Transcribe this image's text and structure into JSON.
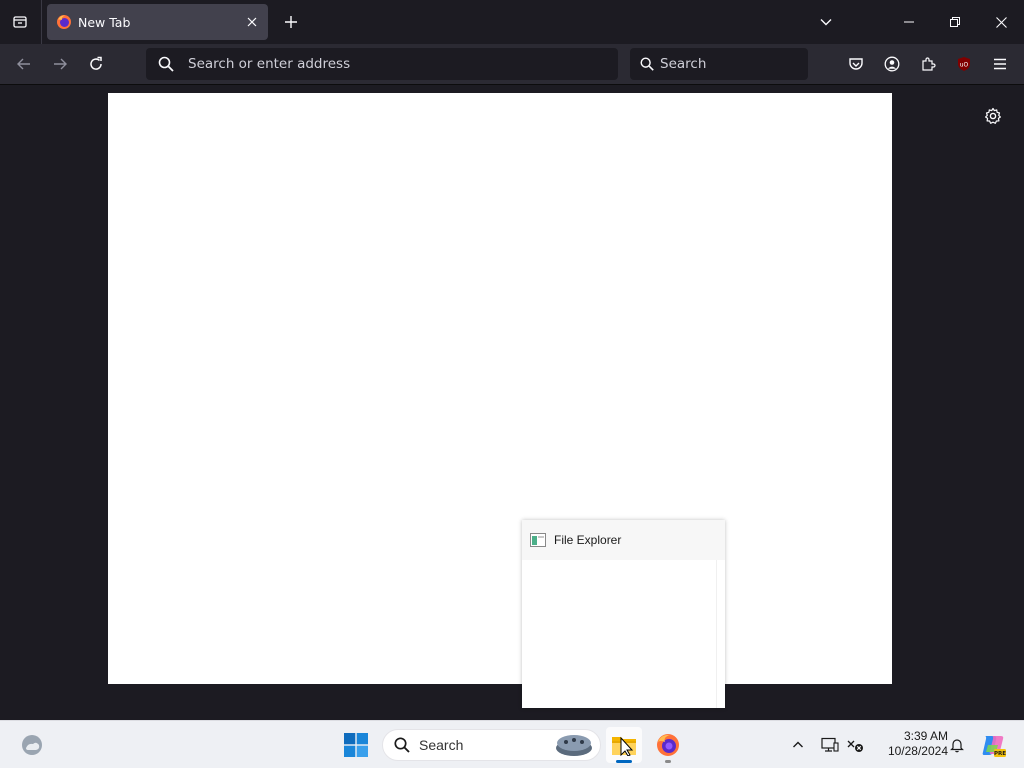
{
  "browser": {
    "tab": {
      "title": "New Tab"
    },
    "urlbar": {
      "placeholder": "Search or enter address"
    },
    "searchbar": {
      "placeholder": "Search"
    },
    "icons": {
      "tab_overview": "list-all-tabs-icon",
      "favicon": "firefox-icon",
      "tab_close": "close-icon",
      "new_tab": "plus-icon",
      "tab_list": "chevron-down-icon",
      "minimize": "minimize-icon",
      "restore": "restore-icon",
      "close_window": "close-icon",
      "back": "arrow-left-icon",
      "forward": "arrow-right-icon",
      "reload": "reload-icon",
      "search": "search-icon",
      "pocket": "pocket-icon",
      "account": "account-icon",
      "extensions": "puzzle-icon",
      "ublock": "ublock-origin-icon",
      "menu": "hamburger-menu-icon",
      "settings": "gear-icon"
    }
  },
  "thumbnail": {
    "title": "File Explorer",
    "icon": "file-explorer-window-icon"
  },
  "taskbar": {
    "search_label": "Search",
    "clock": {
      "time": "3:39 AM",
      "date": "10/28/2024"
    },
    "icons": {
      "widgets": "weather-widget-icon",
      "start": "windows-start-icon",
      "search": "search-icon",
      "search_highlight": "search-highlight-icon",
      "explorer": "file-explorer-icon",
      "firefox": "firefox-icon",
      "tray_chevron": "chevron-up-icon",
      "display": "display-icon",
      "network": "network-disconnected-icon",
      "notifications": "bell-icon",
      "copilot": "copilot-icon"
    }
  },
  "colors": {
    "browser_bg": "#1c1b22",
    "toolbar_bg": "#2b2a33",
    "tab_active": "#42414d",
    "taskbar_bg": "#eef0f4",
    "accent": "#0067c0",
    "ublock_red": "#800000"
  }
}
